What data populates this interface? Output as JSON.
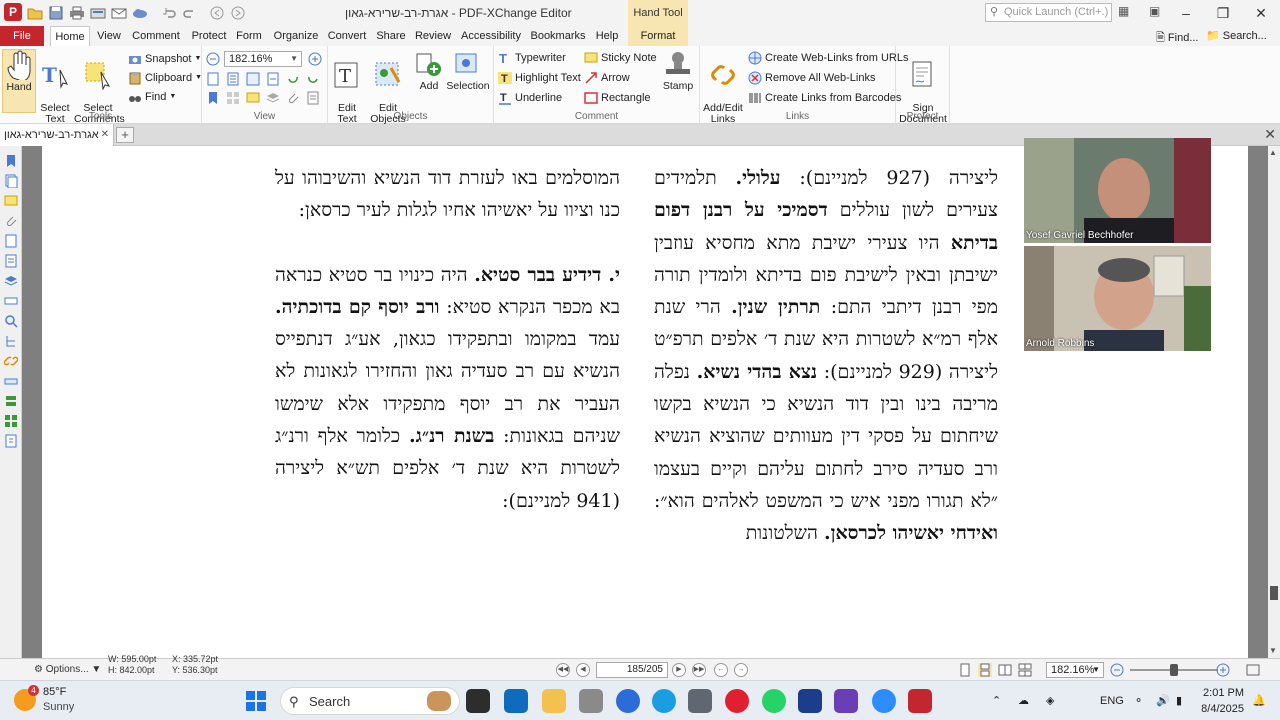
{
  "titlebar": {
    "title": "אגרת-רב-שרירא-גאון - PDF-XChange Editor",
    "contextual_tab": "Hand Tool",
    "quick_launch_placeholder": "Quick Launch (Ctrl+.)"
  },
  "menu": {
    "file": "File",
    "tabs": [
      "Home",
      "View",
      "Comment",
      "Form",
      "Protect",
      "Organize",
      "Convert",
      "Share",
      "Review",
      "Accessibility",
      "Bookmarks",
      "Help",
      "Format"
    ],
    "active_tab": "Home",
    "find": "Find...",
    "search": "Search..."
  },
  "ribbon": {
    "tools": {
      "label": "Tools",
      "hand": "Hand",
      "select_text": "Select\nText",
      "select_comments": "Select\nComments",
      "snapshot": "Snapshot",
      "clipboard": "Clipboard",
      "find": "Find"
    },
    "view": {
      "label": "View",
      "zoom": "182.16%"
    },
    "objects": {
      "label": "Objects",
      "edit_text": "Edit\nText",
      "edit_objects": "Edit\nObjects",
      "add": "Add",
      "selection": "Selection"
    },
    "comment": {
      "label": "Comment",
      "typewriter": "Typewriter",
      "sticky_note": "Sticky Note",
      "highlight_text": "Highlight Text",
      "arrow": "Arrow",
      "underline": "Underline",
      "rectangle": "Rectangle",
      "stamp": "Stamp"
    },
    "links": {
      "label": "Links",
      "add_edit_links": "Add/Edit\nLinks",
      "create_web_links": "Create Web-Links from URLs",
      "remove_web_links": "Remove All Web-Links",
      "links_from_barcodes": "Create Links from Barcodes"
    },
    "protect": {
      "label": "Protect",
      "sign_document": "Sign\nDocument"
    }
  },
  "document": {
    "tab_name": "אגרת-רב-שרירא-גאון",
    "right_column": [
      "ליצירה (927 למניינם): <b>עלולי.</b> תלמידים צעירים לשון עוללים <b>דסמיכי על רבנן דפום בדיתא</b> היו צעירי ישיבת מתא מחסיא עוזבין ישיבתן ובאין לישיבת פום בדיתא ולומדין תורה מפי רבנן דיתבי התם: <b>תרתין שנין.</b> הרי שנת אלף רמ״א לשטרות היא שנת ד׳ אלפים תרפ״ט ליצירה (929 למניינם): <b>נצא בהדי נשיא.</b> נפלה מריבה בינו ובין דוד הנשיא כי הנשיא בקשו שיחתום על פסקי דין מעוותים שהוציא הנשיא ורב סעדיה סירב לחתום עליהם וקיים בעצמו ״לא תגורו מפני איש כי המשפט לאלהים הוא״: <b>ואידחי יאשיהו לכרסאן.</b> השלטונות"
    ],
    "left_column": [
      "המוסלמים באו לעזרת דוד הנשיא והשיבוהו על כנו וציוו על יאשיהו אחיו לגלות לעיר כרסאן:",
      "<b>י. דידיע בבר סטיא.</b> היה כינויו בר סטיא כנראה בא מכפר הנקרא סטיא: <b>ורב יוסף קם בדוכתיה.</b> עמד במקומו ובתפקידו כגאון, אע״ג דנתפייס הנשיא עם רב סעדיה גאון והחזירו לגאונות לא העביר את רב יוסף מתפקידו אלא שימשו שניהם בגאונות: <b>בשנת רנ״ג.</b> כלומר אלף ורנ״ג לשטרות היא שנת ד׳ אלפים תש״א ליצירה (941 למניינם):"
    ]
  },
  "video": {
    "participant1": "Yosef Gavriel Bechhofer",
    "participant2": "Arnold Robbins"
  },
  "statusbar": {
    "options": "Options...",
    "width": "W: 595.00pt",
    "height": "H: 842.00pt",
    "x": "X: 335.72pt",
    "y": "Y: 536.30pt",
    "current_page": "185",
    "total_pages": "/205",
    "zoom": "182.16%"
  },
  "taskbar": {
    "temperature": "85°F",
    "condition": "Sunny",
    "weather_badge": "4",
    "search": "Search",
    "lang": "ENG",
    "time": "2:01 PM",
    "date": "8/4/2025"
  },
  "colors": {
    "brand_red": "#c4262e",
    "contextual_tab": "#f7e6b1",
    "doc_bg": "#7f7f7f"
  }
}
